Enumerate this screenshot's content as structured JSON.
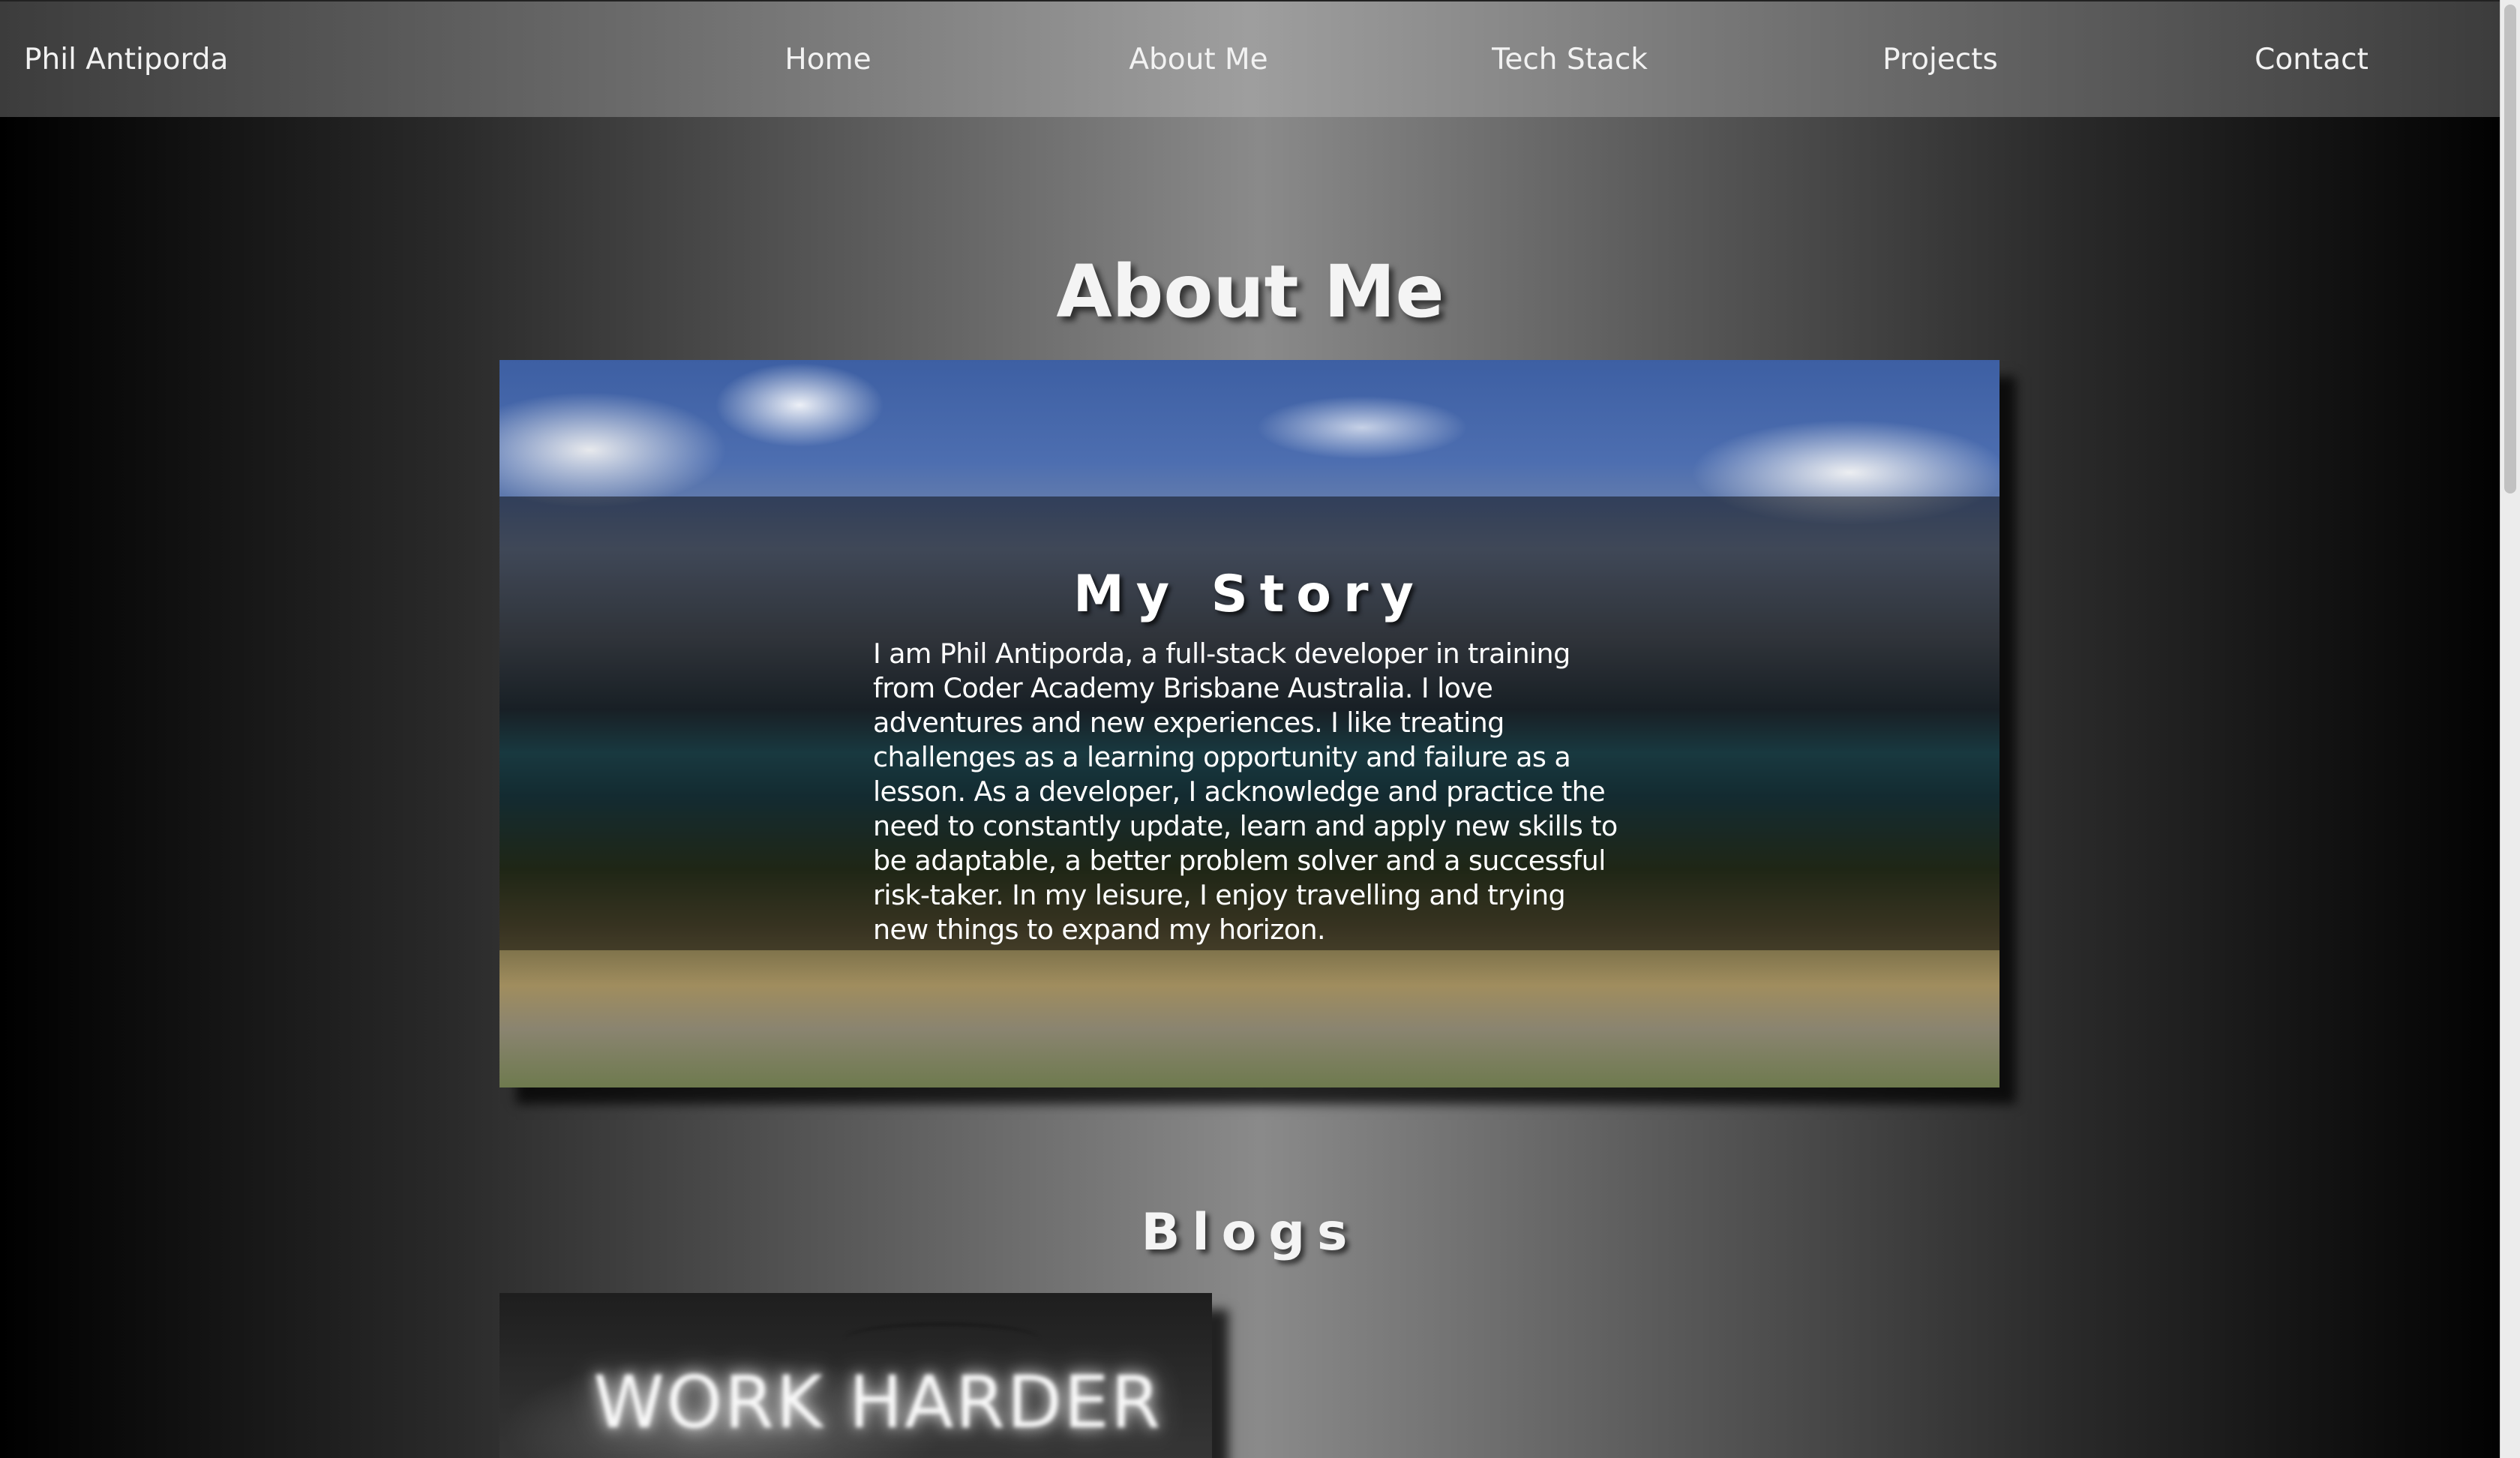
{
  "navbar": {
    "brand": "Phil Antiporda",
    "links": [
      "Home",
      "About Me",
      "Tech Stack",
      "Projects",
      "Contact"
    ]
  },
  "page": {
    "title": "About Me"
  },
  "story": {
    "title": "My Story",
    "text": "I am Phil Antiporda, a full-stack developer in training from Coder Academy Brisbane Australia. I love adventures and new experiences. I like treating challenges as a learning opportunity and failure as a lesson. As a developer, I acknowledge and practice the need to constantly update, learn and apply new skills to be adaptable, a better problem solver and a successful risk-taker. In my leisure, I enjoy travelling and trying new things to expand my horizon."
  },
  "blogs": {
    "title": "Blogs",
    "first_card_sign": "WORK HARDER"
  }
}
